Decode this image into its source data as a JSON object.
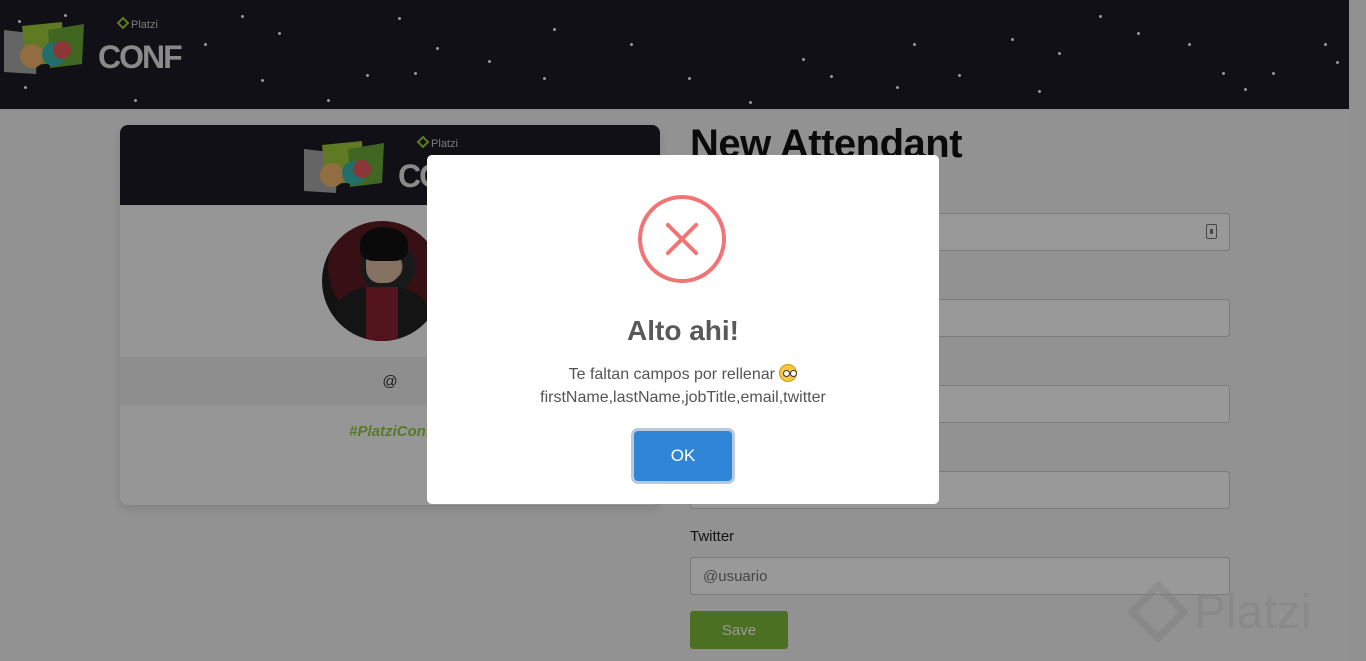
{
  "header": {
    "logo_brand": "Platzi",
    "logo_text": "CONF"
  },
  "badge": {
    "logo_brand": "Platzi",
    "logo_text": "CONF",
    "twitter_handle": "@",
    "hashtag": "#PlatziConf"
  },
  "form": {
    "title": "New Attendant",
    "twitter_label": "Twitter",
    "twitter_placeholder": "@usuario",
    "save_label": "Save"
  },
  "modal": {
    "title": "Alto ahi!",
    "message": "Te faltan campos por rellenar",
    "missing_fields": "firstName,lastName,jobTitle,email,twitter",
    "ok_label": "OK",
    "icon": "error-x-icon"
  },
  "watermark": {
    "text": "Platzi"
  },
  "colors": {
    "navbar_bg": "#1b1b26",
    "accent_green": "#7dbb3a",
    "error_red": "#f27474",
    "ok_blue": "#3085d6"
  }
}
